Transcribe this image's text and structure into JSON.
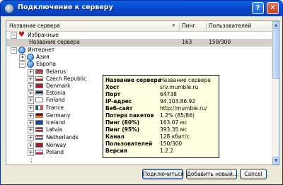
{
  "window": {
    "title": "Подключение к серверу",
    "help_label": "?",
    "close_label": "✕",
    "app_icon": "mumble-icon"
  },
  "columns": {
    "name": "Название сервера",
    "ping": "Пинг",
    "users": "Пользователей"
  },
  "tree": {
    "favorites": {
      "label": "Избранные",
      "icon": "heart-icon",
      "expander": "−",
      "server": {
        "name": "Название сервера",
        "ping": "163",
        "users": "150/300"
      }
    },
    "internet": {
      "label": "Интернет",
      "icon": "globe-icon",
      "expander": "−"
    },
    "asia": {
      "label": "Азия",
      "icon": "globe-icon",
      "expander": "+"
    },
    "europe": {
      "label": "Европа",
      "icon": "globe-icon",
      "expander": "−"
    },
    "countries": [
      {
        "label": "Belarus",
        "flag": "belarus-flag",
        "colors": [
          "#c8313e",
          "#4aa657"
        ]
      },
      {
        "label": "Czech Republic",
        "flag": "czech-flag",
        "colors": [
          "#ffffff",
          "#d7141a"
        ]
      },
      {
        "label": "Denmark",
        "flag": "denmark-flag",
        "colors": [
          "#c8102e",
          "#ffffff"
        ]
      },
      {
        "label": "Estonia",
        "flag": "estonia-flag",
        "colors": [
          "#0072ce",
          "#000000"
        ]
      },
      {
        "label": "Finland",
        "flag": "finland-flag",
        "colors": [
          "#ffffff",
          "#003580"
        ]
      },
      {
        "label": "France",
        "flag": "france-flag",
        "colors": [
          "#0055a4",
          "#ef4135"
        ]
      },
      {
        "label": "Germany",
        "flag": "germany-flag",
        "colors": [
          "#000000",
          "#ffce00"
        ]
      },
      {
        "label": "Iceland",
        "flag": "iceland-flag",
        "colors": [
          "#02529c",
          "#dc1e35"
        ]
      },
      {
        "label": "Latvia",
        "flag": "latvia-flag",
        "colors": [
          "#9e3039",
          "#ffffff"
        ]
      },
      {
        "label": "Netherlands",
        "flag": "netherlands-flag",
        "colors": [
          "#ae1c28",
          "#21468b"
        ]
      },
      {
        "label": "Norway",
        "flag": "norway-flag",
        "colors": [
          "#ba0c2f",
          "#00205b"
        ]
      },
      {
        "label": "Poland",
        "flag": "poland-flag",
        "colors": [
          "#ffffff",
          "#dc143c"
        ]
      }
    ]
  },
  "tooltip": [
    {
      "key": "Название сервера",
      "value": "Название сервера"
    },
    {
      "key": "Хост",
      "value": "srv.mumble.ru"
    },
    {
      "key": "Порт",
      "value": "64738"
    },
    {
      "key": "IP-адрес",
      "value": "94.103.86.92"
    },
    {
      "key": "Веб-сайт",
      "value": "http://mumble.ru/"
    },
    {
      "key": "Потеря пакетов",
      "value": "1.2% (85/86)"
    },
    {
      "key": "Пинг (80%)",
      "value": "163.07 мс"
    },
    {
      "key": "Пинг (95%)",
      "value": "393.35 мс"
    },
    {
      "key": "Канал",
      "value": "128 кбит/с"
    },
    {
      "key": "Пользователей",
      "value": "150/300"
    },
    {
      "key": "Версия",
      "value": "1.2.2"
    }
  ],
  "buttons": {
    "connect": "Подключиться",
    "add_new": "Добавить новый...",
    "cancel": "Cancel"
  }
}
